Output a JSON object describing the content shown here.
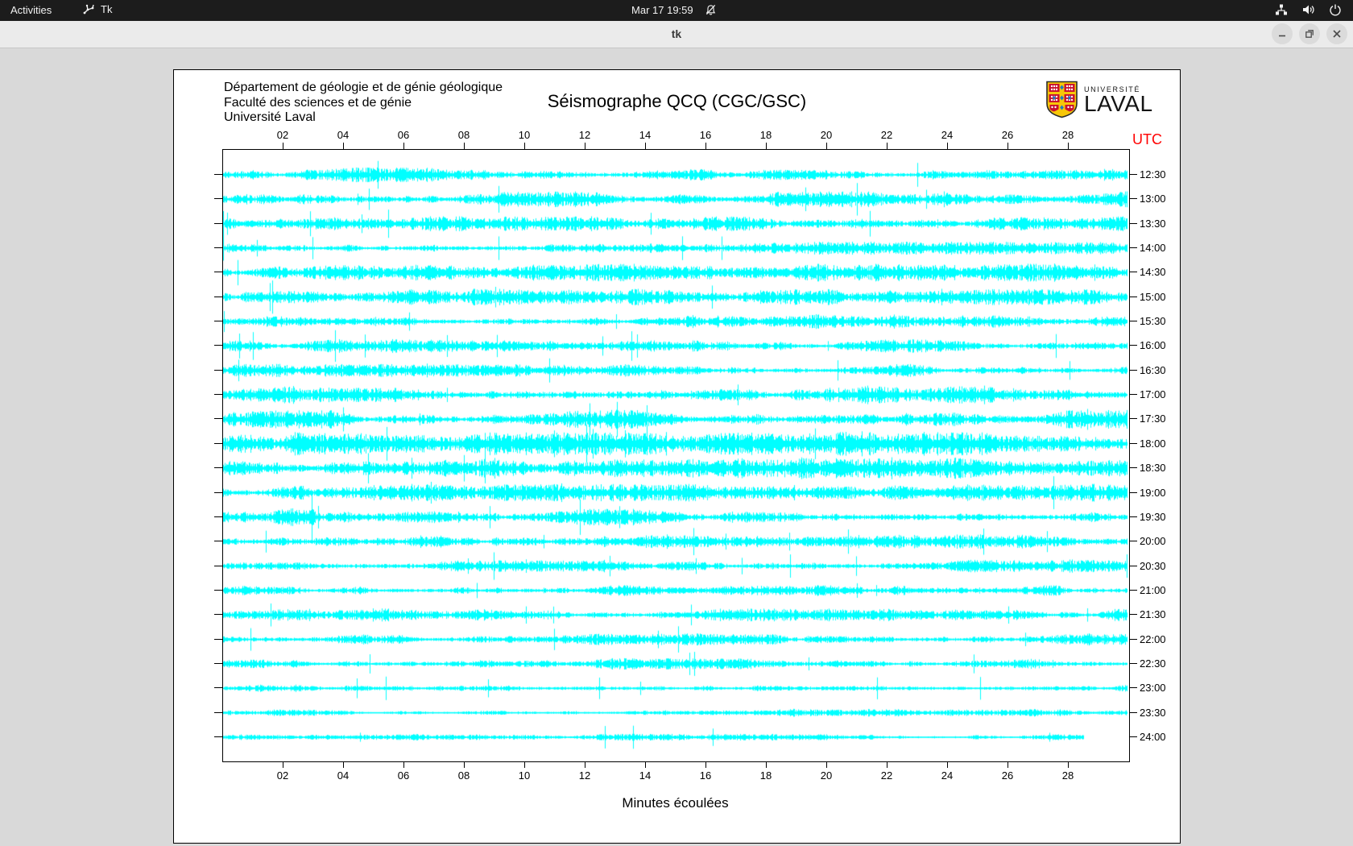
{
  "topbar": {
    "activities_label": "Activities",
    "app_indicator": "Tk",
    "clock": "Mar 17 19:59"
  },
  "titlebar": {
    "title": "tk"
  },
  "app": {
    "header_lines": [
      "Département de géologie et de génie géologique",
      "Faculté des sciences et de génie",
      "Université Laval"
    ],
    "title": "Séismographe QCQ (CGC/GSC)",
    "logo": {
      "top": "UNIVERSITÉ",
      "bottom": "LAVAL"
    },
    "utc_label": "UTC",
    "xlabel": "Minutes écoulées"
  },
  "chart_data": {
    "type": "seismogram-helicorder",
    "title": "Séismographe QCQ (CGC/GSC)",
    "xlabel": "Minutes écoulées",
    "x_range_minutes": [
      0,
      30
    ],
    "x_ticks": [
      "02",
      "04",
      "06",
      "08",
      "10",
      "12",
      "14",
      "16",
      "18",
      "20",
      "22",
      "24",
      "26",
      "28"
    ],
    "right_axis_label": "UTC",
    "trace_color": "#00ffff",
    "utc_color": "#ff0000",
    "rows": [
      {
        "label": "12:30",
        "amp": 3.4,
        "end": 1.0
      },
      {
        "label": "13:00",
        "amp": 3.8,
        "end": 1.0
      },
      {
        "label": "13:30",
        "amp": 3.4,
        "end": 1.0
      },
      {
        "label": "14:00",
        "amp": 3.0,
        "end": 1.0
      },
      {
        "label": "14:30",
        "amp": 4.2,
        "end": 1.0
      },
      {
        "label": "15:00",
        "amp": 3.8,
        "end": 1.0
      },
      {
        "label": "15:30",
        "amp": 3.4,
        "end": 1.0
      },
      {
        "label": "16:00",
        "amp": 3.2,
        "end": 1.0
      },
      {
        "label": "16:30",
        "amp": 3.0,
        "end": 1.0
      },
      {
        "label": "17:00",
        "amp": 4.4,
        "end": 1.0
      },
      {
        "label": "17:30",
        "amp": 4.4,
        "end": 1.0
      },
      {
        "label": "18:00",
        "amp": 5.4,
        "end": 1.0
      },
      {
        "label": "18:30",
        "amp": 5.0,
        "end": 1.0
      },
      {
        "label": "19:00",
        "amp": 4.0,
        "end": 1.0
      },
      {
        "label": "19:30",
        "amp": 3.8,
        "end": 1.0,
        "burst_start": true
      },
      {
        "label": "20:00",
        "amp": 3.4,
        "end": 1.0
      },
      {
        "label": "20:30",
        "amp": 3.0,
        "end": 1.0
      },
      {
        "label": "21:00",
        "amp": 3.0,
        "end": 1.0
      },
      {
        "label": "21:30",
        "amp": 3.0,
        "end": 1.0
      },
      {
        "label": "22:00",
        "amp": 2.8,
        "end": 1.0
      },
      {
        "label": "22:30",
        "amp": 2.6,
        "end": 1.0
      },
      {
        "label": "23:00",
        "amp": 2.2,
        "end": 1.0
      },
      {
        "label": "23:30",
        "amp": 1.8,
        "end": 1.0
      },
      {
        "label": "24:00",
        "amp": 1.6,
        "end": 0.952
      }
    ]
  }
}
